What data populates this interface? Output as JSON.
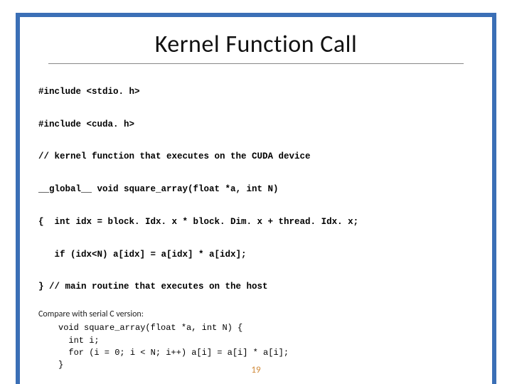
{
  "title": "Kernel Function Call",
  "code_lines": {
    "l1": "#include <stdio. h>",
    "l2": "#include <cuda. h>",
    "l3": "// kernel function that executes on the CUDA device",
    "l4": "__global__ void square_array(float *a, int N)",
    "l5": "{  int idx = block. Idx. x * block. Dim. x + thread. Idx. x;",
    "l6": "   if (idx<N) a[idx] = a[idx] * a[idx];",
    "l7": "} // main routine that executes on the host"
  },
  "compare_label": "Compare with serial C version:",
  "serial_code": "void square_array(float *a, int N) {\n  int i;\n  for (i = 0; i < N; i++) a[i] = a[i] * a[i];\n}",
  "page_number": "19"
}
